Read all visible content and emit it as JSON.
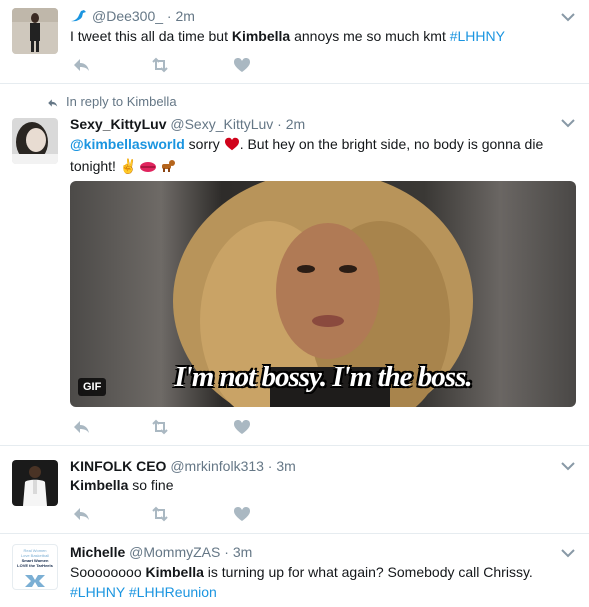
{
  "tweets": [
    {
      "handle": "@Dee300_",
      "time": "2m",
      "text_parts": {
        "a": "I tweet this all da time but ",
        "b": "Kimbella",
        "c": " annoys me so much kmt ",
        "d": "#LHHNY"
      }
    },
    {
      "reply_to": "In reply to Kimbella",
      "name": "Sexy_KittyLuv",
      "handle": "@Sexy_KittyLuv",
      "time": "2m",
      "text_parts": {
        "mention": "@kimbellasworld",
        "a": " sorry ",
        "b": ". But hey on the bright side, no body is gonna die tonight! "
      },
      "gif_badge": "GIF",
      "gif_caption": "I'm not bossy. I'm the boss."
    },
    {
      "name": "KINFOLK CEO",
      "handle": "@mrkinfolk313",
      "time": "3m",
      "text_parts": {
        "b": "Kimbella",
        "a": " so fine"
      }
    },
    {
      "name": "Michelle",
      "handle": "@MommyZAS",
      "time": "3m",
      "text_parts": {
        "a": "Soooooooo ",
        "b": "Kimbella",
        "c": " is turning up for what again? Somebody call Chrissy.",
        "tag1": "#LHHNY",
        "tag2": "#LHHReunion"
      },
      "avatar_text": {
        "l1": "Real Women",
        "l2": "Love Basketball",
        "l3": "Smart Women",
        "l4": "LOVE the TarHeels"
      }
    }
  ],
  "colors": {
    "link": "#1b95e0",
    "muted": "#657786",
    "heart": "#e0245e"
  },
  "icons": [
    "reply-icon",
    "retweet-icon",
    "like-icon",
    "caret-down-icon",
    "bird-icon"
  ]
}
